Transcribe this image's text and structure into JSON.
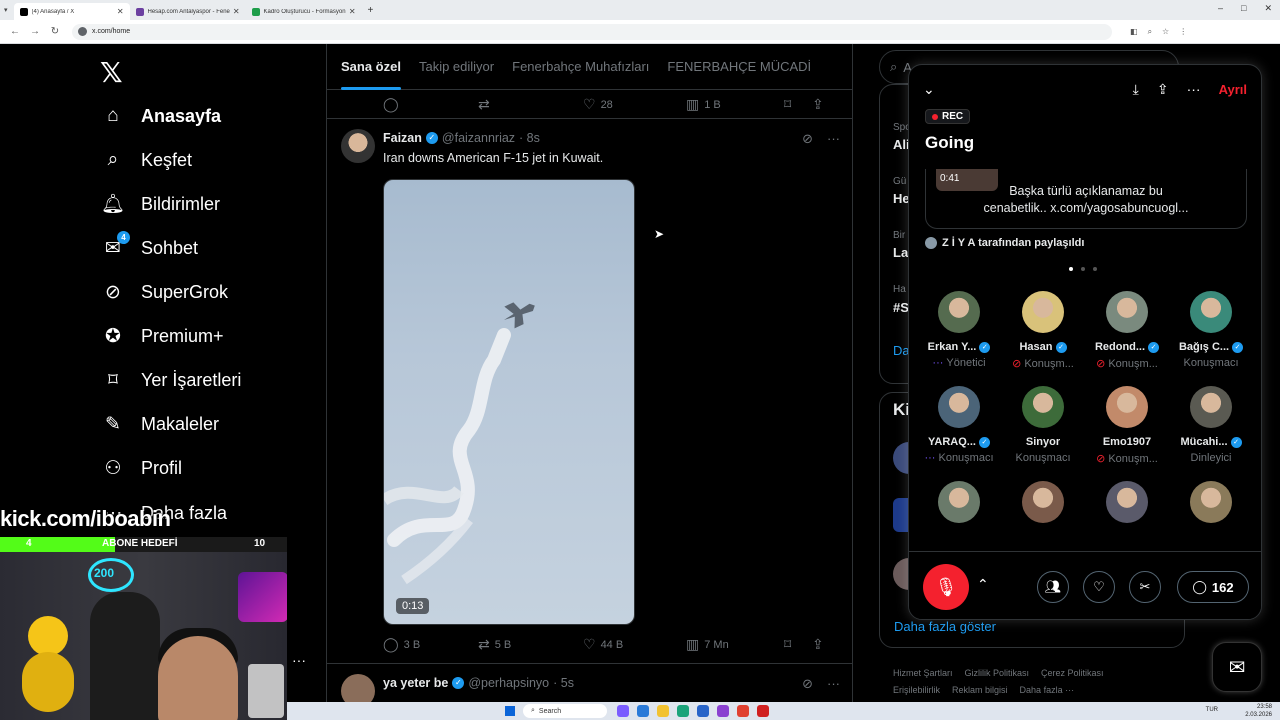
{
  "browser": {
    "tabs": [
      {
        "title": "(4) Anasayfa / X",
        "color": "#000000"
      },
      {
        "title": "Hesap.com Antalyaspor - Fenerbahçe",
        "color": "#6b3fa0"
      },
      {
        "title": "Kadro Oluşturucu - Formasyon",
        "color": "#1e9e4a"
      }
    ],
    "new_tab": "+",
    "url": "x.com/home",
    "window_controls": [
      "–",
      "□",
      "✕"
    ]
  },
  "nav": {
    "logo": "𝕏",
    "items": [
      {
        "label": "Anasayfa",
        "icon": "⌂",
        "icon_name": "home-icon",
        "bold": true
      },
      {
        "label": "Keşfet",
        "icon": "⌕",
        "icon_name": "search-icon"
      },
      {
        "label": "Bildirimler",
        "icon": "🔔︎",
        "icon_name": "bell-icon"
      },
      {
        "label": "Sohbet",
        "icon": "✉",
        "icon_name": "mail-icon",
        "badge": "4"
      },
      {
        "label": "SuperGrok",
        "icon": "⊘",
        "icon_name": "grok-icon"
      },
      {
        "label": "Premium+",
        "icon": "✪",
        "icon_name": "verified-badge-icon"
      },
      {
        "label": "Yer İşaretleri",
        "icon": "⌑",
        "icon_name": "bookmark-icon"
      },
      {
        "label": "Makaleler",
        "icon": "✎",
        "icon_name": "article-icon"
      },
      {
        "label": "Profil",
        "icon": "⚇",
        "icon_name": "person-icon"
      },
      {
        "label": "Daha fazla",
        "icon": "⋯",
        "icon_name": "more-icon"
      }
    ]
  },
  "feed": {
    "tabs": [
      "Sana özel",
      "Takip ediliyor",
      "Fenerbahçe Muhafızları",
      "FENERBAHÇE MÜCADİ"
    ],
    "prev_actions": {
      "reply": "",
      "repost": "",
      "like": "28",
      "views": "1 B"
    },
    "tweet": {
      "name": "Faizan",
      "handle": "@faizannriaz",
      "time": "· 8s",
      "text": "Iran downs American F-15 jet in Kuwait.",
      "video_time": "0:13",
      "actions": {
        "reply": "3 B",
        "repost": "5 B",
        "like": "44 B",
        "views": "7 Mn"
      }
    },
    "next_tweet": {
      "name": "ya yeter be",
      "handle": "@perhapsinyo",
      "time": "· 5s"
    }
  },
  "right": {
    "search_placeholder": "A",
    "trends": [
      {
        "label": "Spo",
        "value": "Ali"
      },
      {
        "label": "Gü",
        "value": "He"
      },
      {
        "label": "Bir",
        "value": "La"
      },
      {
        "label": "Ha",
        "value": "#S"
      }
    ],
    "show_more_short": "Da",
    "who_to_follow_short": "Ki",
    "show_more": "Daha fazla göster",
    "footer_row1": [
      "Hizmet Şartları",
      "Gizlilik Politikası",
      "Çerez Politikası"
    ],
    "footer_row2": [
      "Erişilebilirlik",
      "Reklam bilgisi",
      "Daha fazla ···"
    ]
  },
  "space": {
    "leave": "Ayrıl",
    "rec": "REC",
    "title": "Going",
    "pinned_time": "0:41",
    "pinned_text_1": "Başka türlü açıklanamaz bu",
    "pinned_text_2": "cenabetlik..  x.com/yagosabuncuogl...",
    "shared_by": "Z İ Y A tarafından paylaşıldı",
    "participants": [
      {
        "name": "Erkan Y...",
        "role": "Yönetici",
        "verified": true,
        "role_icon": "···",
        "color": "#556b4f"
      },
      {
        "name": "Hasan",
        "role": "Konuşm...",
        "verified": true,
        "role_icon": "⊘",
        "color": "#d9c27a"
      },
      {
        "name": "Redond...",
        "role": "Konuşm...",
        "verified": true,
        "role_icon": "⊘",
        "color": "#7a8a7e"
      },
      {
        "name": "Bağış C...",
        "role": "Konuşmacı",
        "verified": true,
        "role_icon": "",
        "color": "#3a8a7a"
      },
      {
        "name": "YARAQ...",
        "role": "Konuşmacı",
        "verified": true,
        "role_icon": "···",
        "color": "#4b6478"
      },
      {
        "name": "Sinyor",
        "role": "Konuşmacı",
        "verified": false,
        "role_icon": "",
        "color": "#3d6b3a"
      },
      {
        "name": "Emo1907",
        "role": "Konuşm...",
        "verified": false,
        "role_icon": "⊘",
        "color": "#c28a6a"
      },
      {
        "name": "Mücahi...",
        "role": "Dinleyici",
        "verified": true,
        "role_icon": "",
        "color": "#5a5a52"
      },
      {
        "name": "",
        "role": "",
        "verified": false,
        "role_icon": "",
        "color": "#6a7a6a"
      },
      {
        "name": "",
        "role": "",
        "verified": false,
        "role_icon": "",
        "color": "#7a5a4a"
      },
      {
        "name": "",
        "role": "",
        "verified": false,
        "role_icon": "",
        "color": "#5a5a6a"
      },
      {
        "name": "",
        "role": "",
        "verified": false,
        "role_icon": "",
        "color": "#8a7a5a"
      }
    ],
    "comment_count": "162"
  },
  "overlay": {
    "kick": "kick.com/iboabin",
    "goal_current": "4",
    "goal_label": "ABONE HEDEFİ",
    "goal_target": "10",
    "goal_fraction": 0.4,
    "cam_text": "200"
  },
  "taskbar": {
    "search": "Search",
    "lang": "TUR",
    "time": "23:58",
    "date": "2.03.2026"
  },
  "colors": {
    "accent": "#1d9bf0",
    "danger": "#f4212e",
    "kick": "#53fc18"
  }
}
